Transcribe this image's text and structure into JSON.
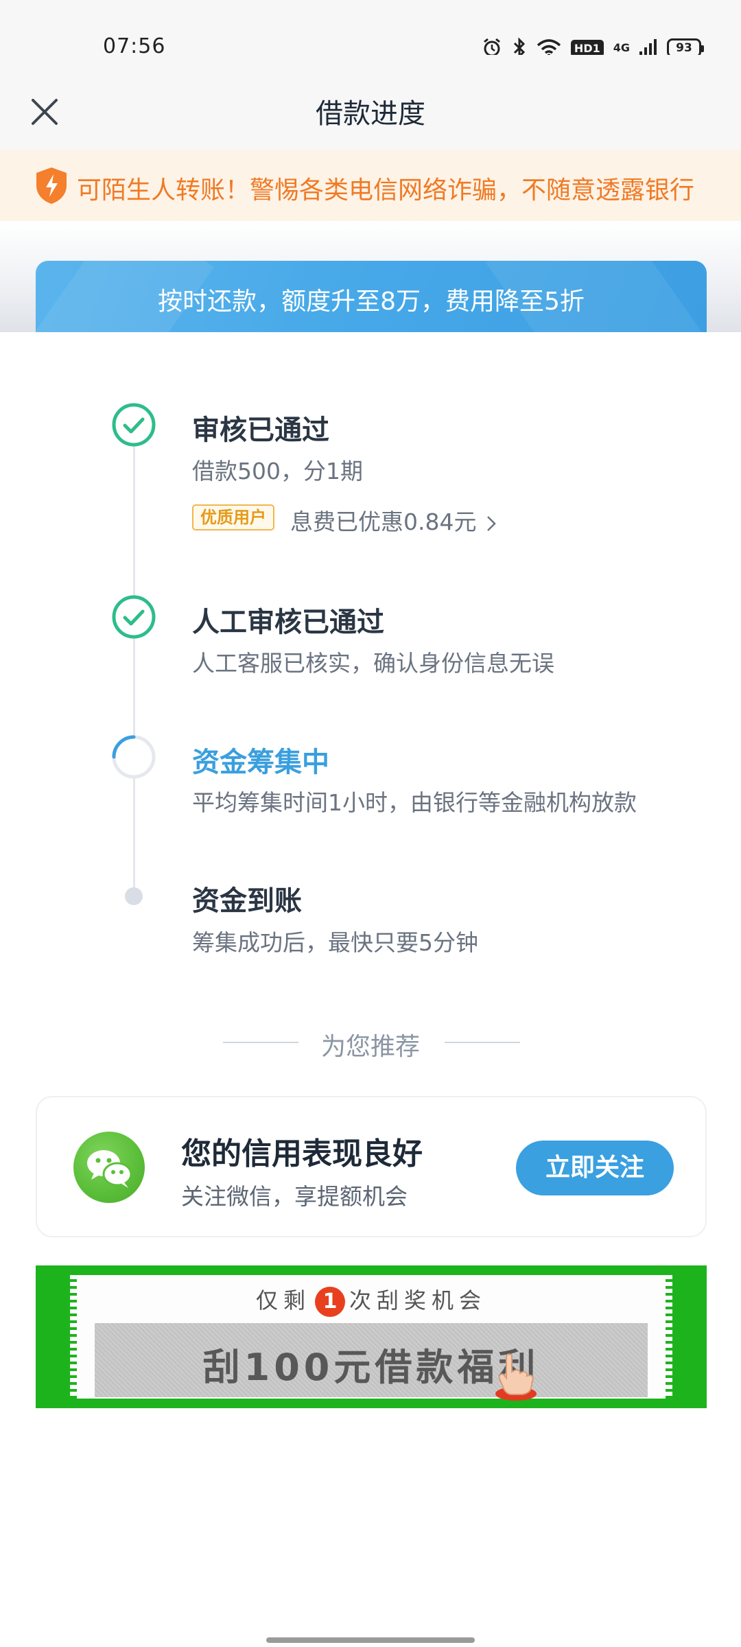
{
  "status_bar": {
    "time": "07:56",
    "battery": "93",
    "hd_label": "HD1",
    "network": "4G"
  },
  "nav": {
    "title": "借款进度"
  },
  "notice": {
    "text": "可陌生人转账！警惕各类电信网络诈骗，不随意透露银行"
  },
  "promo": {
    "text": "按时还款，额度升至8万，费用降至5折"
  },
  "steps": [
    {
      "title": "审核已通过",
      "desc": "借款500，分1期",
      "status": "done"
    },
    {
      "title": "人工审核已通过",
      "desc": "人工客服已核实，确认身份信息无误",
      "status": "done"
    },
    {
      "title": "资金筹集中",
      "desc": "平均筹集时间1小时，由银行等金融机构放款",
      "status": "in-progress"
    },
    {
      "title": "资金到账",
      "desc": "筹集成功后，最快只要5分钟",
      "status": "pending"
    }
  ],
  "discount": {
    "badge": "优质用户",
    "text": "息费已优惠0.84元"
  },
  "recommend": {
    "heading": "为您推荐"
  },
  "wechat_card": {
    "title": "您的信用表现良好",
    "subtitle": "关注微信，享提额机会",
    "button": "立即关注"
  },
  "scratch_card": {
    "prefix": "仅剩",
    "count": "1",
    "suffix": "次刮奖机会",
    "label": "刮100元借款福利"
  },
  "colors": {
    "accent_blue": "#3aa0e0",
    "success_green": "#2ebd8a",
    "warning_orange": "#f07a25",
    "scratch_green": "#1db31d"
  }
}
